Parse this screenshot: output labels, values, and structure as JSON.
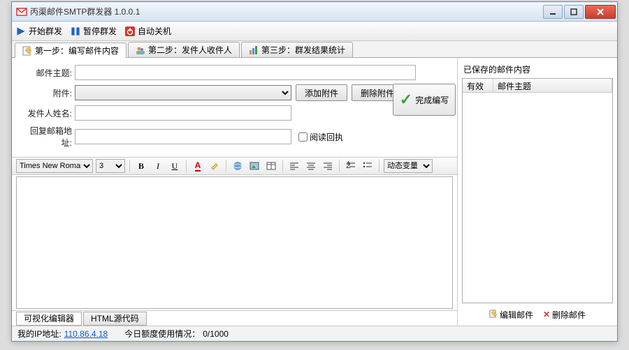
{
  "window": {
    "title": "丙渠邮件SMTP群发器 1.0.0.1"
  },
  "toolbar": {
    "start": "开始群发",
    "pause": "暂停群发",
    "shutdown": "自动关机"
  },
  "tabs": {
    "t1": "第一步：编写邮件内容",
    "t2": "第二步：发件人收件人",
    "t3": "第三步：群发结果统计"
  },
  "form": {
    "subject_label": "邮件主题:",
    "attach_label": "附件:",
    "add_attach": "添加附件",
    "del_attach": "删除附件",
    "sender_label": "发件人姓名:",
    "reply_label": "回复邮箱地址:",
    "read_receipt": "阅读回执",
    "done": "完成编写"
  },
  "editor": {
    "font": "Times New Roman",
    "size": "3",
    "dynvar": "动态变量"
  },
  "editor_tabs": {
    "visual": "可视化编辑器",
    "html": "HTML源代码"
  },
  "right": {
    "title": "已保存的邮件内容",
    "col_valid": "有效",
    "col_subject": "邮件主题",
    "edit": "编辑邮件",
    "delete": "删除邮件"
  },
  "status": {
    "ip_label": "我的IP地址:",
    "ip": "110.86.4.18",
    "quota_label": "今日额度使用情况：",
    "quota": "0/1000"
  }
}
